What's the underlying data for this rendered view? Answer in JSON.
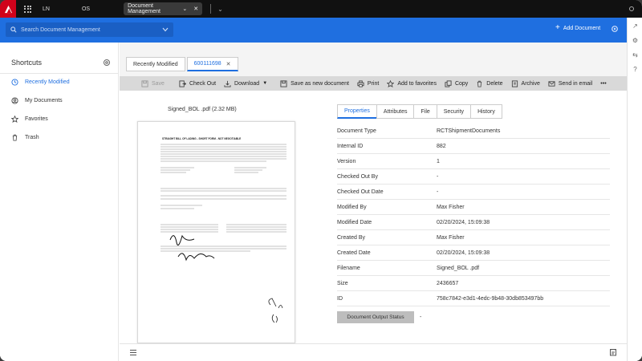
{
  "topbar": {
    "left_text": "LN",
    "left_text2": "OS",
    "tab_label": "Document Management"
  },
  "header": {
    "search_placeholder": "Search Document Management",
    "add_document_label": "Add Document"
  },
  "sidebar": {
    "title": "Shortcuts",
    "items": [
      {
        "label": "Recently Modified",
        "icon": "clock-icon",
        "active": true
      },
      {
        "label": "My Documents",
        "icon": "user-icon",
        "active": false
      },
      {
        "label": "Favorites",
        "icon": "star-icon",
        "active": false
      },
      {
        "label": "Trash",
        "icon": "trash-icon",
        "active": false
      }
    ]
  },
  "main": {
    "tabs": [
      {
        "label": "Recently Modified"
      },
      {
        "label": "600111698"
      }
    ],
    "toolbar": {
      "save": "Save",
      "check_out": "Check Out",
      "download": "Download",
      "save_as_new": "Save as new document",
      "print": "Print",
      "add_to_favorites": "Add to favorites",
      "copy": "Copy",
      "delete": "Delete",
      "archive": "Archive",
      "send_in_email": "Send in email",
      "more": "•••"
    },
    "preview": {
      "file_label": "Signed_BOL .pdf  (2.32 MB)",
      "doc_title": "STRAIGHT BILL OF LADING - SHORT FORM - NOT NEGOTIABLE"
    },
    "properties": {
      "tabs": [
        "Properties",
        "Attributes",
        "File",
        "Security",
        "History"
      ],
      "rows": [
        {
          "key": "Document Type",
          "value": "RCTShipmentDocuments"
        },
        {
          "key": "Internal ID",
          "value": "882"
        },
        {
          "key": "Version",
          "value": "1"
        },
        {
          "key": "Checked Out By",
          "value": "-"
        },
        {
          "key": "Checked Out Date",
          "value": "-"
        },
        {
          "key": "Modified By",
          "value": "Max Fisher"
        },
        {
          "key": "Modified Date",
          "value": "02/20/2024, 15:09:38"
        },
        {
          "key": "Created By",
          "value": "Max Fisher"
        },
        {
          "key": "Created Date",
          "value": "02/20/2024, 15:09:38"
        },
        {
          "key": "Filename",
          "value": "Signed_BOL .pdf"
        },
        {
          "key": "Size",
          "value": "2436657"
        },
        {
          "key": "ID",
          "value": "758c7842-e3d1-4edc-9b48-30db853497bb"
        }
      ],
      "status_button": "Document Output Status",
      "status_value": "-"
    }
  },
  "colors": {
    "brand_blue": "#1f6fe0",
    "logo_red": "#d0021b",
    "topbar_black": "#111111"
  }
}
